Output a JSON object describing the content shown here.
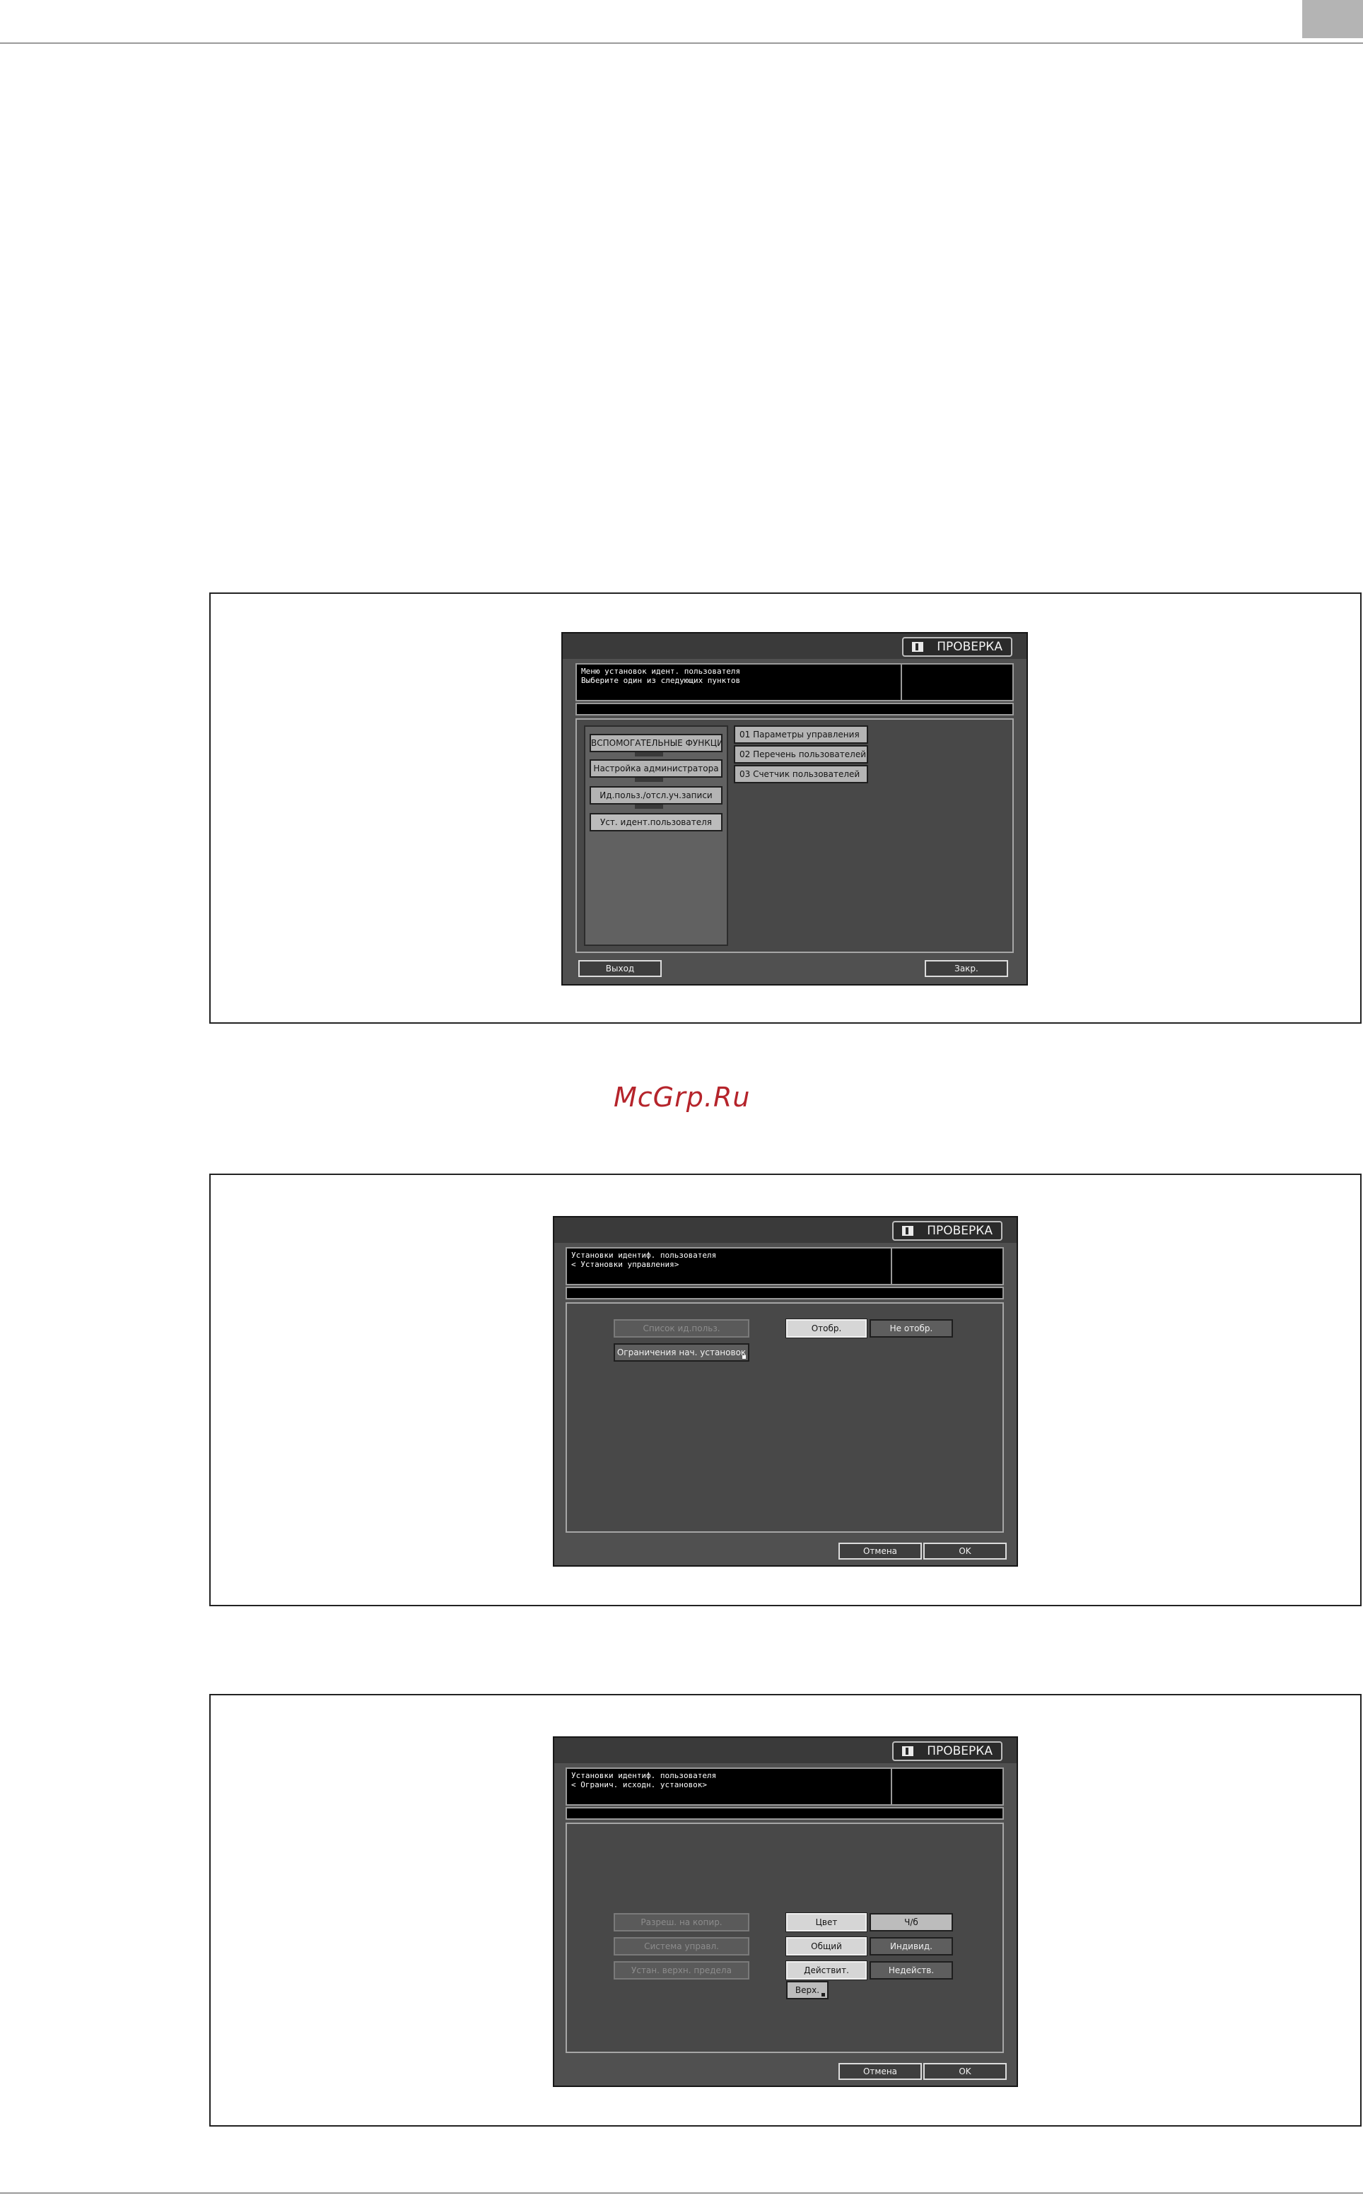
{
  "header_tab": "",
  "watermark": "McGrp.Ru",
  "screens": [
    {
      "check_label": "ПРОВЕРКА",
      "message": "Меню установок идент. пользователя\nВыберите один из следующих пунктов",
      "left_buttons": [
        "ВСПОМОГАТЕЛЬНЫЕ ФУНКЦИИ",
        "Настройка администратора",
        "Ид.польз./отсл.уч.записи",
        "Уст. идент.пользователя"
      ],
      "right_buttons": [
        "01 Параметры управления",
        "02 Перечень пользователей",
        "03 Счетчик пользователей"
      ],
      "exit_label": "Выход",
      "close_label": "Закр."
    },
    {
      "check_label": "ПРОВЕРКА",
      "message": "Установки идентиф. пользователя\n< Установки управления>",
      "items": [
        "Список ид.польз.",
        "Ограничения нач. установок"
      ],
      "show_label": "Отобр.",
      "hide_label": "Не отобр.",
      "cancel_label": "Отмена",
      "ok_label": "OK"
    },
    {
      "check_label": "ПРОВЕРКА",
      "message": "Установки идентиф. пользователя\n< Огранич. исходн. установок>",
      "items": [
        "Разреш. на копир.",
        "Система управл.",
        "Устан. верхн. предела"
      ],
      "options": [
        [
          "Цвет",
          "Ч/б"
        ],
        [
          "Общий",
          "Индивид."
        ],
        [
          "Действит.",
          "Недейств."
        ]
      ],
      "upper_label": "Верх.",
      "cancel_label": "Отмена",
      "ok_label": "OK"
    }
  ]
}
